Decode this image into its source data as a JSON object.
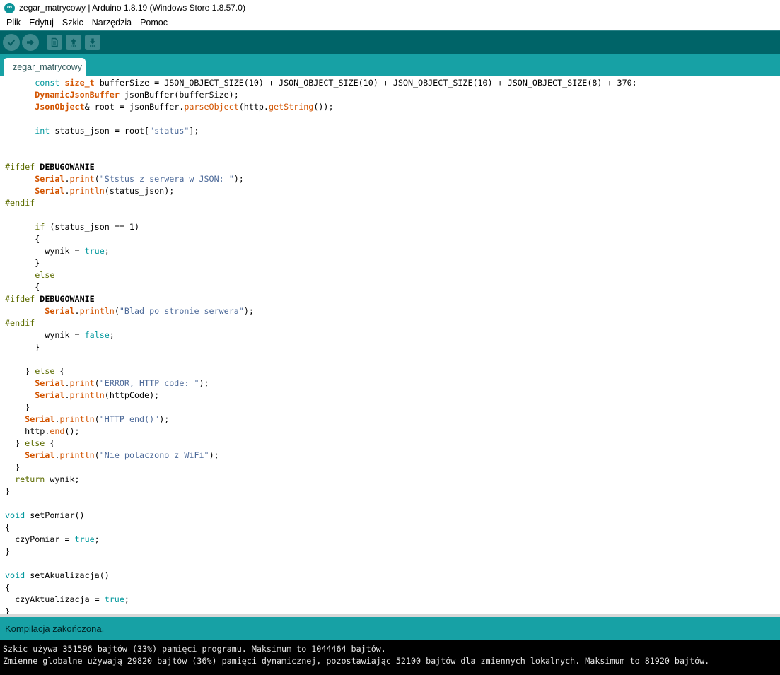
{
  "window": {
    "title": "zegar_matrycowy | Arduino 1.8.19 (Windows Store 1.8.57.0)",
    "app_icon": "arduino-infinity-icon",
    "app_icon_glyph": "∞"
  },
  "menu": {
    "items": [
      "Plik",
      "Edytuj",
      "Szkic",
      "Narzędzia",
      "Pomoc"
    ]
  },
  "toolbar": {
    "buttons": [
      "verify",
      "upload",
      "new-sketch",
      "open",
      "save"
    ]
  },
  "tabs": {
    "active_label": "zegar_matrycowy"
  },
  "colors": {
    "toolbar_bg": "#006468",
    "toolbar_button": "#3f8a8e",
    "tabstrip_bg": "#17a1a5",
    "statusbar_bg": "#17a1a5",
    "status_text": "#002325",
    "console_bg": "#000000",
    "console_text": "#e6e6e6",
    "syntax_type_keyword": "#00979c",
    "syntax_library_class_bold": "#d35400",
    "syntax_function": "#d35400",
    "syntax_flow_preprocessor": "#5e6d03",
    "syntax_string": "#4d6a99"
  },
  "editor": {
    "lines": [
      [
        {
          "t": "      "
        },
        {
          "t": "const",
          "c": "k"
        },
        {
          "t": " "
        },
        {
          "t": "size_t",
          "c": "kb"
        },
        {
          "t": " bufferSize = JSON_OBJECT_SIZE(10) + JSON_OBJECT_SIZE(10) + JSON_OBJECT_SIZE(10) + JSON_OBJECT_SIZE(8) + 370;"
        }
      ],
      [
        {
          "t": "      "
        },
        {
          "t": "DynamicJsonBuffer",
          "c": "kb"
        },
        {
          "t": " jsonBuffer(bufferSize);"
        }
      ],
      [
        {
          "t": "      "
        },
        {
          "t": "JsonObject",
          "c": "kb"
        },
        {
          "t": "& root = jsonBuffer."
        },
        {
          "t": "parseObject",
          "c": "fn"
        },
        {
          "t": "(http."
        },
        {
          "t": "getString",
          "c": "fn"
        },
        {
          "t": "());"
        }
      ],
      [],
      [
        {
          "t": "      "
        },
        {
          "t": "int",
          "c": "k"
        },
        {
          "t": " status_json = root["
        },
        {
          "t": "\"status\"",
          "c": "s"
        },
        {
          "t": "];"
        }
      ],
      [],
      [],
      [
        {
          "t": "#ifdef",
          "c": "pp"
        },
        {
          "t": " "
        },
        {
          "t": "DEBUGOWANIE",
          "c": "d"
        }
      ],
      [
        {
          "t": "      "
        },
        {
          "t": "Serial",
          "c": "kb"
        },
        {
          "t": "."
        },
        {
          "t": "print",
          "c": "fn"
        },
        {
          "t": "("
        },
        {
          "t": "\"Ststus z serwera w JSON: \"",
          "c": "s"
        },
        {
          "t": ");"
        }
      ],
      [
        {
          "t": "      "
        },
        {
          "t": "Serial",
          "c": "kb"
        },
        {
          "t": "."
        },
        {
          "t": "println",
          "c": "fn"
        },
        {
          "t": "(status_json);"
        }
      ],
      [
        {
          "t": "#endif",
          "c": "pp"
        }
      ],
      [],
      [
        {
          "t": "      "
        },
        {
          "t": "if",
          "c": "pp"
        },
        {
          "t": " (status_json == 1)"
        }
      ],
      [
        {
          "t": "      {"
        }
      ],
      [
        {
          "t": "        wynik = "
        },
        {
          "t": "true",
          "c": "k"
        },
        {
          "t": ";"
        }
      ],
      [
        {
          "t": "      }"
        }
      ],
      [
        {
          "t": "      "
        },
        {
          "t": "else",
          "c": "pp"
        }
      ],
      [
        {
          "t": "      {"
        }
      ],
      [
        {
          "t": "#ifdef",
          "c": "pp"
        },
        {
          "t": " "
        },
        {
          "t": "DEBUGOWANIE",
          "c": "d"
        }
      ],
      [
        {
          "t": "        "
        },
        {
          "t": "Serial",
          "c": "kb"
        },
        {
          "t": "."
        },
        {
          "t": "println",
          "c": "fn"
        },
        {
          "t": "("
        },
        {
          "t": "\"Blad po stronie serwera\"",
          "c": "s"
        },
        {
          "t": ");"
        }
      ],
      [
        {
          "t": "#endif",
          "c": "pp"
        }
      ],
      [
        {
          "t": "        wynik = "
        },
        {
          "t": "false",
          "c": "k"
        },
        {
          "t": ";"
        }
      ],
      [
        {
          "t": "      }"
        }
      ],
      [],
      [
        {
          "t": "    } "
        },
        {
          "t": "else",
          "c": "pp"
        },
        {
          "t": " {"
        }
      ],
      [
        {
          "t": "      "
        },
        {
          "t": "Serial",
          "c": "kb"
        },
        {
          "t": "."
        },
        {
          "t": "print",
          "c": "fn"
        },
        {
          "t": "("
        },
        {
          "t": "\"ERROR, HTTP code: \"",
          "c": "s"
        },
        {
          "t": ");"
        }
      ],
      [
        {
          "t": "      "
        },
        {
          "t": "Serial",
          "c": "kb"
        },
        {
          "t": "."
        },
        {
          "t": "println",
          "c": "fn"
        },
        {
          "t": "(httpCode);"
        }
      ],
      [
        {
          "t": "    }"
        }
      ],
      [
        {
          "t": "    "
        },
        {
          "t": "Serial",
          "c": "kb"
        },
        {
          "t": "."
        },
        {
          "t": "println",
          "c": "fn"
        },
        {
          "t": "("
        },
        {
          "t": "\"HTTP end()\"",
          "c": "s"
        },
        {
          "t": ");"
        }
      ],
      [
        {
          "t": "    http."
        },
        {
          "t": "end",
          "c": "fn"
        },
        {
          "t": "();"
        }
      ],
      [
        {
          "t": "  } "
        },
        {
          "t": "else",
          "c": "pp"
        },
        {
          "t": " {"
        }
      ],
      [
        {
          "t": "    "
        },
        {
          "t": "Serial",
          "c": "kb"
        },
        {
          "t": "."
        },
        {
          "t": "println",
          "c": "fn"
        },
        {
          "t": "("
        },
        {
          "t": "\"Nie polaczono z WiFi\"",
          "c": "s"
        },
        {
          "t": ");"
        }
      ],
      [
        {
          "t": "  }"
        }
      ],
      [
        {
          "t": "  "
        },
        {
          "t": "return",
          "c": "pp"
        },
        {
          "t": " wynik;"
        }
      ],
      [
        {
          "t": "}"
        }
      ],
      [],
      [
        {
          "t": "void",
          "c": "k"
        },
        {
          "t": " setPomiar()"
        }
      ],
      [
        {
          "t": "{"
        }
      ],
      [
        {
          "t": "  czyPomiar = "
        },
        {
          "t": "true",
          "c": "k"
        },
        {
          "t": ";"
        }
      ],
      [
        {
          "t": "}"
        }
      ],
      [],
      [
        {
          "t": "void",
          "c": "k"
        },
        {
          "t": " setAkualizacja()"
        }
      ],
      [
        {
          "t": "{"
        }
      ],
      [
        {
          "t": "  czyAktualizacja = "
        },
        {
          "t": "true",
          "c": "k"
        },
        {
          "t": ";"
        }
      ],
      [
        {
          "t": "}"
        }
      ]
    ]
  },
  "status": {
    "message": "Kompilacja zakończona."
  },
  "console": {
    "lines": [
      "Szkic używa 351596 bajtów (33%) pamięci programu. Maksimum to 1044464 bajtów.",
      "Zmienne globalne używają 29820 bajtów (36%) pamięci dynamicznej, pozostawiając 52100 bajtów dla zmiennych lokalnych. Maksimum to 81920 bajtów."
    ]
  }
}
